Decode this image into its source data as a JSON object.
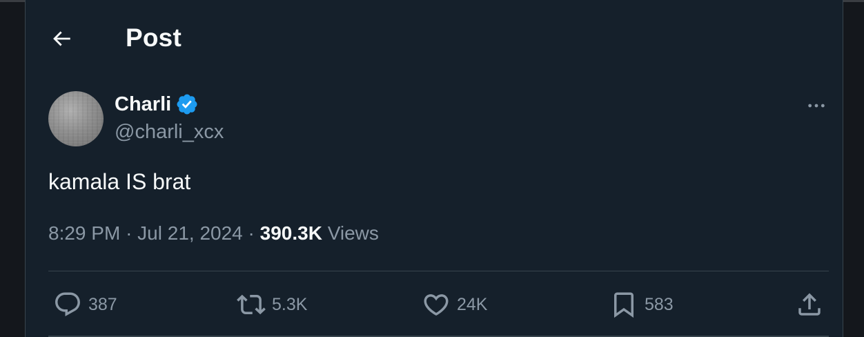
{
  "header": {
    "title": "Post",
    "back_icon": "arrow-left-icon"
  },
  "author": {
    "name": "Charli",
    "handle": "@charli_xcx",
    "verified_color": "#1d9bf0"
  },
  "tweet": {
    "text": "kamala IS brat",
    "time": "8:29 PM",
    "separator": "·",
    "date": "Jul 21, 2024",
    "views_count": "390.3K",
    "views_label": "Views"
  },
  "actions": {
    "replies": "387",
    "reposts": "5.3K",
    "likes": "24K",
    "bookmarks": "583"
  },
  "colors": {
    "background": "#15202b",
    "text_primary": "#f7f9f9",
    "text_secondary": "#8b98a5",
    "border": "#38444d"
  }
}
